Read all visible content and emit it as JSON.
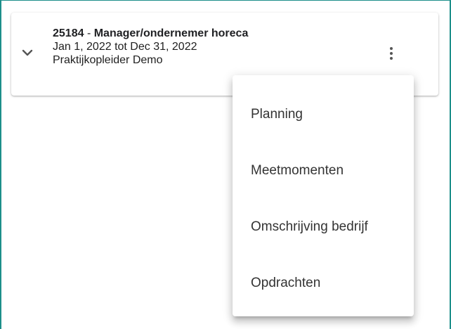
{
  "card": {
    "code": "25184",
    "separator": " - ",
    "title": "Manager/ondernemer horeca",
    "period": "Jan 1, 2022 tot Dec 31, 2022",
    "supervisor": "Praktijkopleider Demo"
  },
  "icons": {
    "expand": "chevron-down-icon",
    "more": "more-vert-icon"
  },
  "menu": {
    "items": [
      {
        "label": "Planning"
      },
      {
        "label": "Meetmomenten"
      },
      {
        "label": "Omschrijving bedrijf"
      },
      {
        "label": "Opdrachten"
      }
    ]
  },
  "colors": {
    "frame_border": "#1d8f8a",
    "text": "#202124"
  }
}
